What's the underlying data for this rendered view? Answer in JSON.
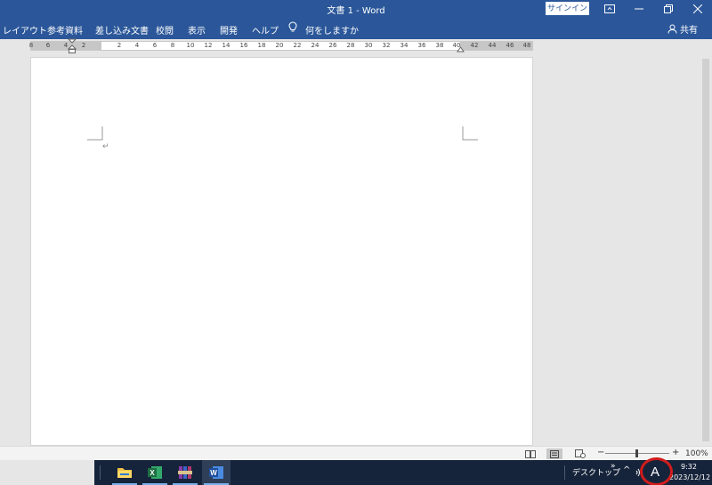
{
  "window": {
    "title": "文書 1  -  Word",
    "signin_label": "サインイン"
  },
  "ribbon": {
    "tabs": [
      "レイアウト",
      "参考資料",
      "差し込み文書",
      "校閲",
      "表示",
      "開発",
      "ヘルプ"
    ],
    "tell_me": "何をしますか",
    "share": "共有"
  },
  "ruler": {
    "left_numbers": [
      "8",
      "6",
      "4",
      "2"
    ],
    "right_numbers": [
      "2",
      "4",
      "6",
      "8",
      "10",
      "12",
      "14",
      "16",
      "18",
      "20",
      "22",
      "24",
      "26",
      "28",
      "30",
      "32",
      "34",
      "36",
      "38",
      "40",
      "42",
      "44",
      "46",
      "48"
    ]
  },
  "document": {
    "paragraph_mark": "↵"
  },
  "statusbar": {
    "zoom_percent": "100%",
    "zoom_minus": "−",
    "zoom_plus": "+"
  },
  "taskbar": {
    "apps": [
      "file-explorer",
      "excel",
      "winrar",
      "word"
    ],
    "desktop_label": "デスクトップ",
    "ime_mode": "A",
    "time": "9:32",
    "date": "2023/12/12"
  },
  "colors": {
    "word_blue": "#2b579a",
    "taskbar": "#16243b",
    "highlight_circle": "#d11c1c"
  }
}
